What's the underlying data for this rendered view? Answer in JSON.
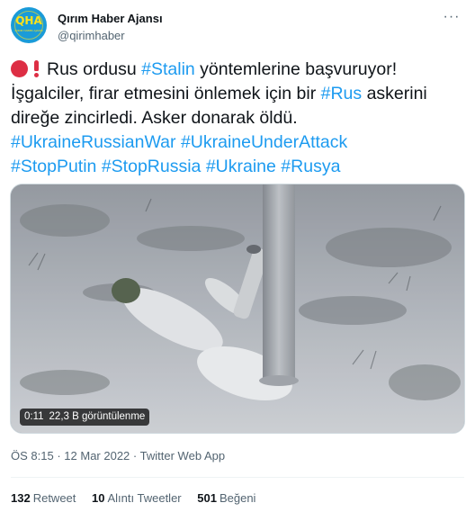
{
  "author": {
    "display_name": "Qırım Haber Ajansı",
    "handle": "@qirimhaber",
    "avatar_text": "QHA",
    "avatar_subtext": "QIRIM HABER AJANSI",
    "more_icon": "more-icon"
  },
  "tweet": {
    "lines": [
      [
        {
          "text": "Rus ordusu ",
          "tag": false
        },
        {
          "text": "#Stalin",
          "tag": true
        },
        {
          "text": " yöntemlerine başvuruyor!",
          "tag": false
        }
      ],
      [
        {
          "text": "İşgalciler, firar etmesini önlemek için bir ",
          "tag": false
        },
        {
          "text": "#Rus",
          "tag": true
        },
        {
          "text": " askerini",
          "tag": false
        }
      ],
      [
        {
          "text": "direğe zincirledi. Asker donarak öldü.",
          "tag": false
        }
      ],
      [
        {
          "text": "#UkraineRussianWar",
          "tag": true
        },
        {
          "text": " ",
          "tag": false
        },
        {
          "text": "#UkraineUnderAttack",
          "tag": true
        }
      ],
      [
        {
          "text": "#StopPutin",
          "tag": true
        },
        {
          "text": " ",
          "tag": false
        },
        {
          "text": "#StopRussia",
          "tag": true
        },
        {
          "text": " ",
          "tag": false
        },
        {
          "text": "#Ukraine",
          "tag": true
        },
        {
          "text": " ",
          "tag": false
        },
        {
          "text": "#Rusya",
          "tag": true
        }
      ]
    ]
  },
  "media": {
    "duration": "0:11",
    "views": "22,3 B görüntülenme"
  },
  "meta": {
    "time": "ÖS 8:15",
    "date": "12 Mar 2022",
    "separator": "·",
    "source": "Twitter Web App"
  },
  "stats": [
    {
      "count": "132",
      "label": "Retweet"
    },
    {
      "count": "10",
      "label": "Alıntı Tweetler"
    },
    {
      "count": "501",
      "label": "Beğeni"
    }
  ],
  "colors": {
    "link": "#1d9bf0",
    "text": "#0f1419",
    "secondary": "#536471",
    "emoji_red": "#dd2e44",
    "avatar_bg": "#1a9bd8",
    "avatar_fg": "#ffe21a"
  }
}
